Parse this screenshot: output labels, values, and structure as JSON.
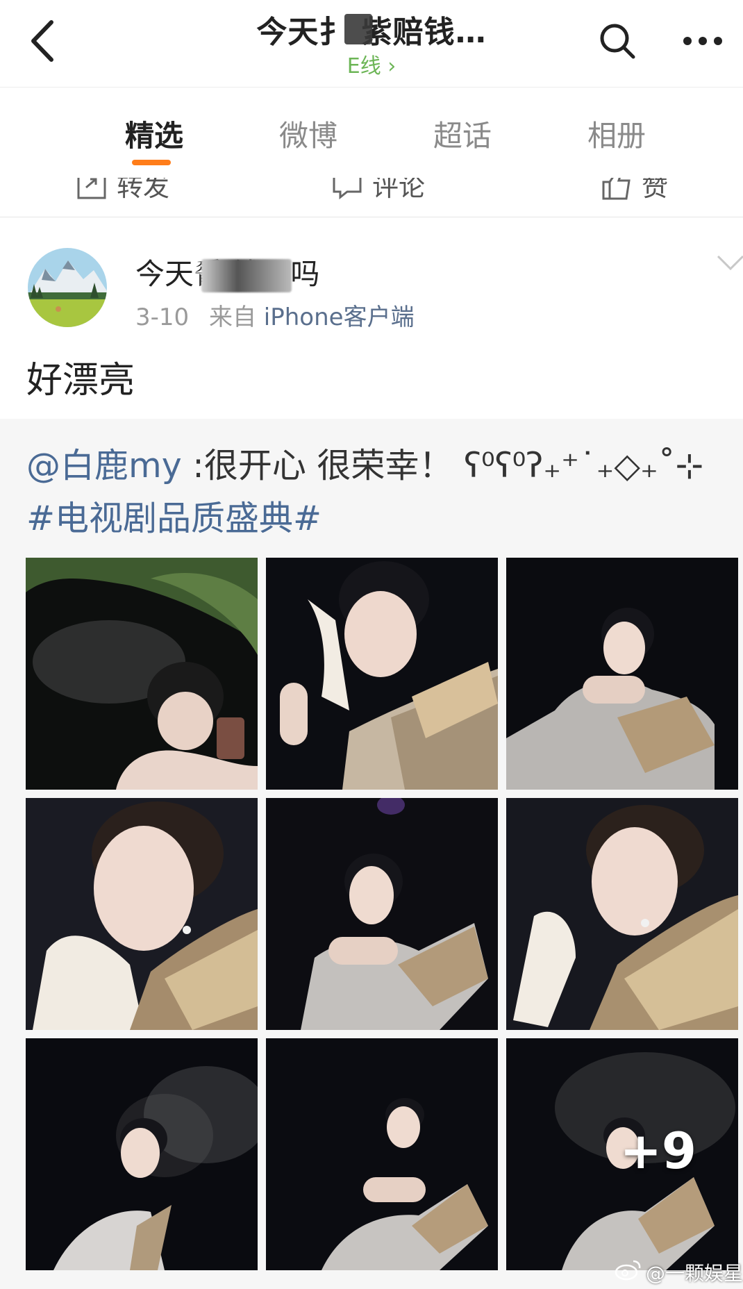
{
  "header": {
    "title": "今天扌 紫赔钱…",
    "subtitle": "E线 ›",
    "icons": {
      "back": "chevron-left-icon",
      "search": "search-icon",
      "more": "more-dots-icon"
    }
  },
  "tabs": [
    {
      "label": "精选",
      "active": true
    },
    {
      "label": "微博",
      "active": false
    },
    {
      "label": "超话",
      "active": false
    },
    {
      "label": "相册",
      "active": false
    }
  ],
  "action_bar": {
    "repost": "转发",
    "comment": "评论",
    "like": "赞"
  },
  "post": {
    "author": "今天𦟝    钱了吗",
    "date": "3-10",
    "source_prefix": "来自",
    "source": "iPhone客户端",
    "text": "好漂亮"
  },
  "repost": {
    "mention": "@白鹿my",
    "body": " :很开心 很荣幸！ ʕ⁰ʕ⁰ʔ₊⁺˙₊◇₊˚⊹",
    "hashtag": "#电视剧品质盛典#",
    "more_count": "+9"
  },
  "watermark": "@一颗娱星",
  "colors": {
    "accent": "#ff7d1a",
    "link": "#4a6a95",
    "subtitle_green": "#6cb556"
  }
}
